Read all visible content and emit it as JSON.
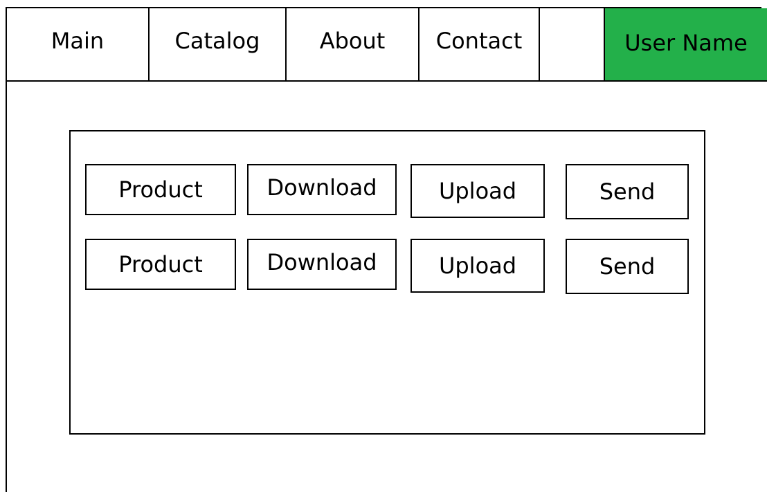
{
  "nav": {
    "items": [
      {
        "label": "Main"
      },
      {
        "label": "Catalog"
      },
      {
        "label": "About"
      },
      {
        "label": "Contact"
      },
      {
        "label": ""
      }
    ],
    "user": {
      "label": "User Name",
      "color": "#23b04a"
    }
  },
  "panel": {
    "rows": [
      {
        "buttons": [
          {
            "label": "Product"
          },
          {
            "label": "Download"
          },
          {
            "label": "Upload"
          },
          {
            "label": "Send"
          }
        ]
      },
      {
        "buttons": [
          {
            "label": "Product"
          },
          {
            "label": "Download"
          },
          {
            "label": "Upload"
          },
          {
            "label": "Send"
          }
        ]
      }
    ]
  }
}
